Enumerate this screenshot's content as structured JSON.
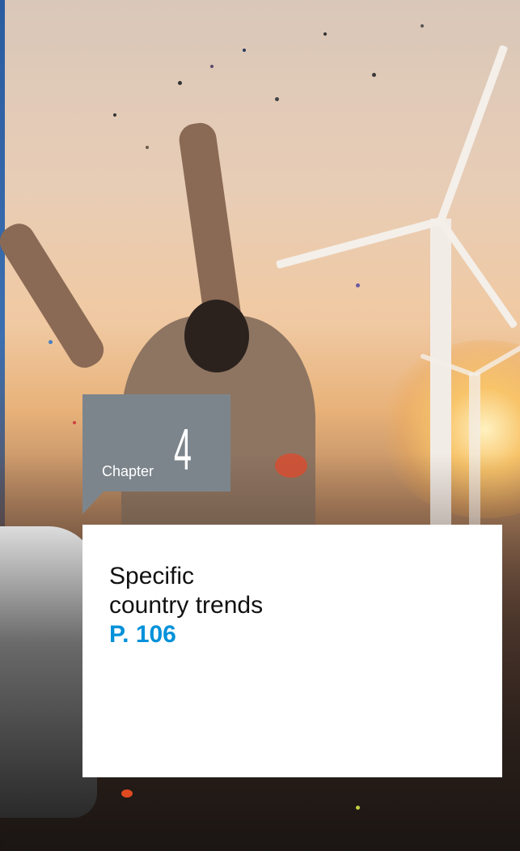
{
  "chapter": {
    "label": "Chapter",
    "number": "4"
  },
  "card": {
    "title_line1": "Specific",
    "title_line2": "country trends",
    "page": "P. 106"
  },
  "colors": {
    "chapter_tag_bg": "#7d858c",
    "page_link": "#0091da",
    "card_bg": "#ffffff"
  }
}
